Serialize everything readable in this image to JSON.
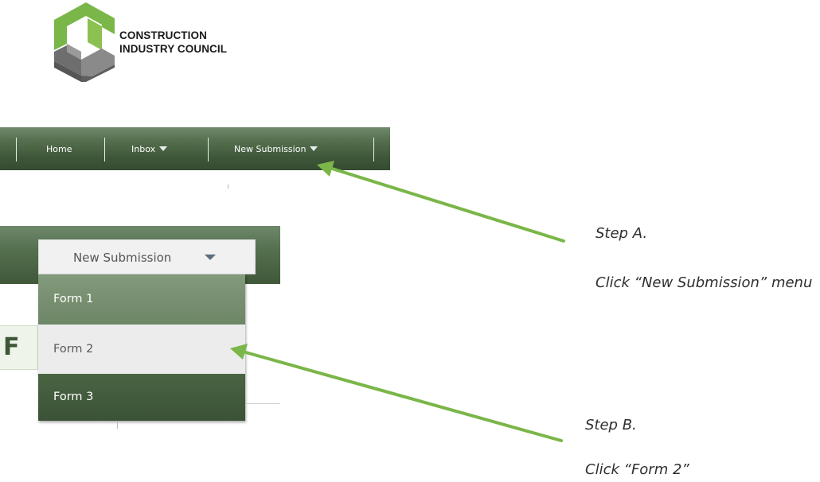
{
  "logo": {
    "line1": "CONSTRUCTION",
    "line2": "INDUSTRY COUNCIL",
    "icon": "cic-logo-icon",
    "colors": {
      "green": "#7ab648",
      "gray": "#707070"
    }
  },
  "navbar": {
    "items": [
      {
        "label": "Home",
        "has_caret": false
      },
      {
        "label": "Inbox",
        "has_caret": true,
        "caret_icon": "caret-down-icon"
      },
      {
        "label": "New Submission",
        "has_caret": true,
        "caret_icon": "caret-down-icon"
      }
    ],
    "color": "#4a6344"
  },
  "menu": {
    "button_label": "New Submission",
    "caret_icon": "caret-down-icon",
    "items": [
      {
        "label": "Form 1"
      },
      {
        "label": "Form 2"
      },
      {
        "label": "Form 3"
      }
    ]
  },
  "background": {
    "partial_heading": "F"
  },
  "annotations": {
    "step_a": {
      "title": "Step A.",
      "body": "Click “New Submission” menu"
    },
    "step_b": {
      "title": "Step B.",
      "body": "Click “Form 2”"
    },
    "arrow_color": "#7ab648"
  }
}
